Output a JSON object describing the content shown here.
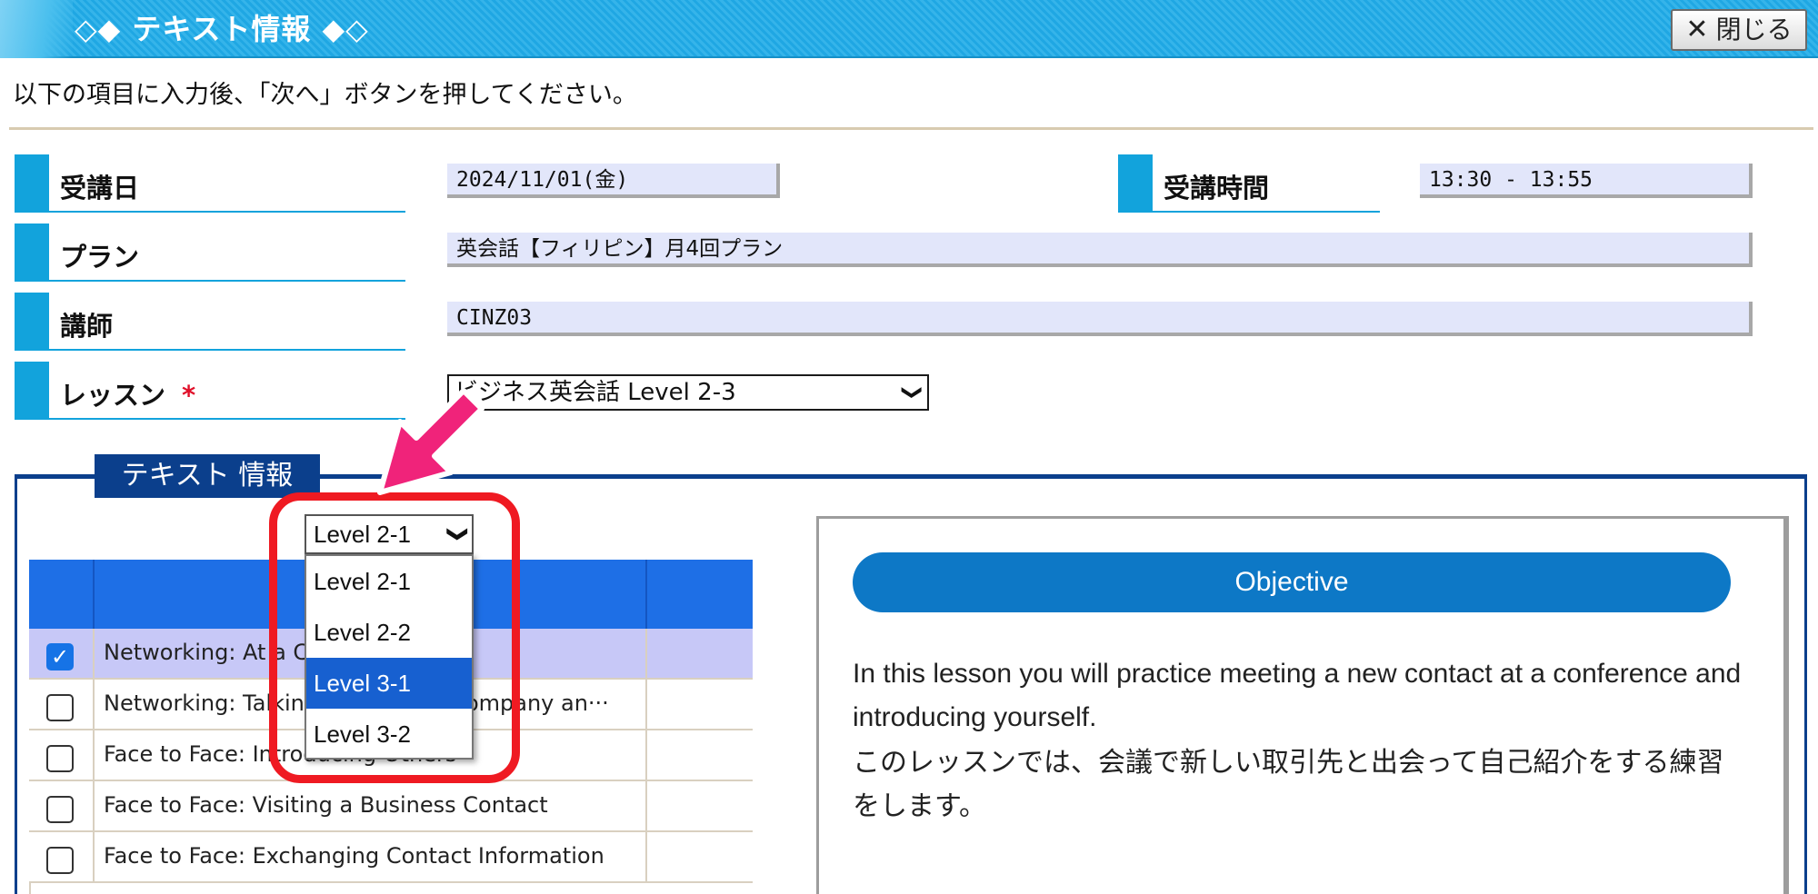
{
  "window": {
    "title": "◇◆ テキスト情報 ◆◇",
    "close_label": "閉じる"
  },
  "instruction": "以下の項目に入力後、「次へ」ボタンを押してください。",
  "form": {
    "date_label": "受講日",
    "date_value": "2024/11/01(金)",
    "time_label": "受講時間",
    "time_value": "13:30 - 13:55",
    "plan_label": "プラン",
    "plan_value": "英会話【フィリピン】月4回プラン",
    "teacher_label": "講師",
    "teacher_value": "CINZ03",
    "lesson_label": "レッスン",
    "lesson_required": "*",
    "lesson_value": "ビジネス英会話 Level 2-3"
  },
  "text_info": {
    "section_title": "テキスト 情報",
    "level_selected": "Level 2-1",
    "level_options": [
      "Level 2-1",
      "Level 2-2",
      "Level 3-1",
      "Level 3-2"
    ],
    "rows": [
      {
        "title": "Networking: At a Conference",
        "checked": true
      },
      {
        "title": "Networking: Talking About Your Company an···",
        "checked": false
      },
      {
        "title": "Face to Face: Introducing Others",
        "checked": false
      },
      {
        "title": "Face to Face: Visiting a Business Contact",
        "checked": false
      },
      {
        "title": "Face to Face: Exchanging Contact Information",
        "checked": false
      }
    ]
  },
  "objective": {
    "heading": "Objective",
    "text_en": "In this lesson you will practice meeting a new contact at a conference and introducing yourself.",
    "text_ja": "このレッスンでは、会議で新しい取引先と出会って自己紹介をする練習をします。"
  },
  "icons": {
    "check": "✓",
    "chevron": "❯",
    "close": "✕"
  },
  "colors": {
    "accent": "#12a3dc",
    "section": "#0b3f8c",
    "table_header": "#1e6fe6",
    "selected_row": "#c7c8f7",
    "objective": "#0d78c6",
    "highlight": "#ef1a22",
    "arrow": "#f0237a"
  }
}
